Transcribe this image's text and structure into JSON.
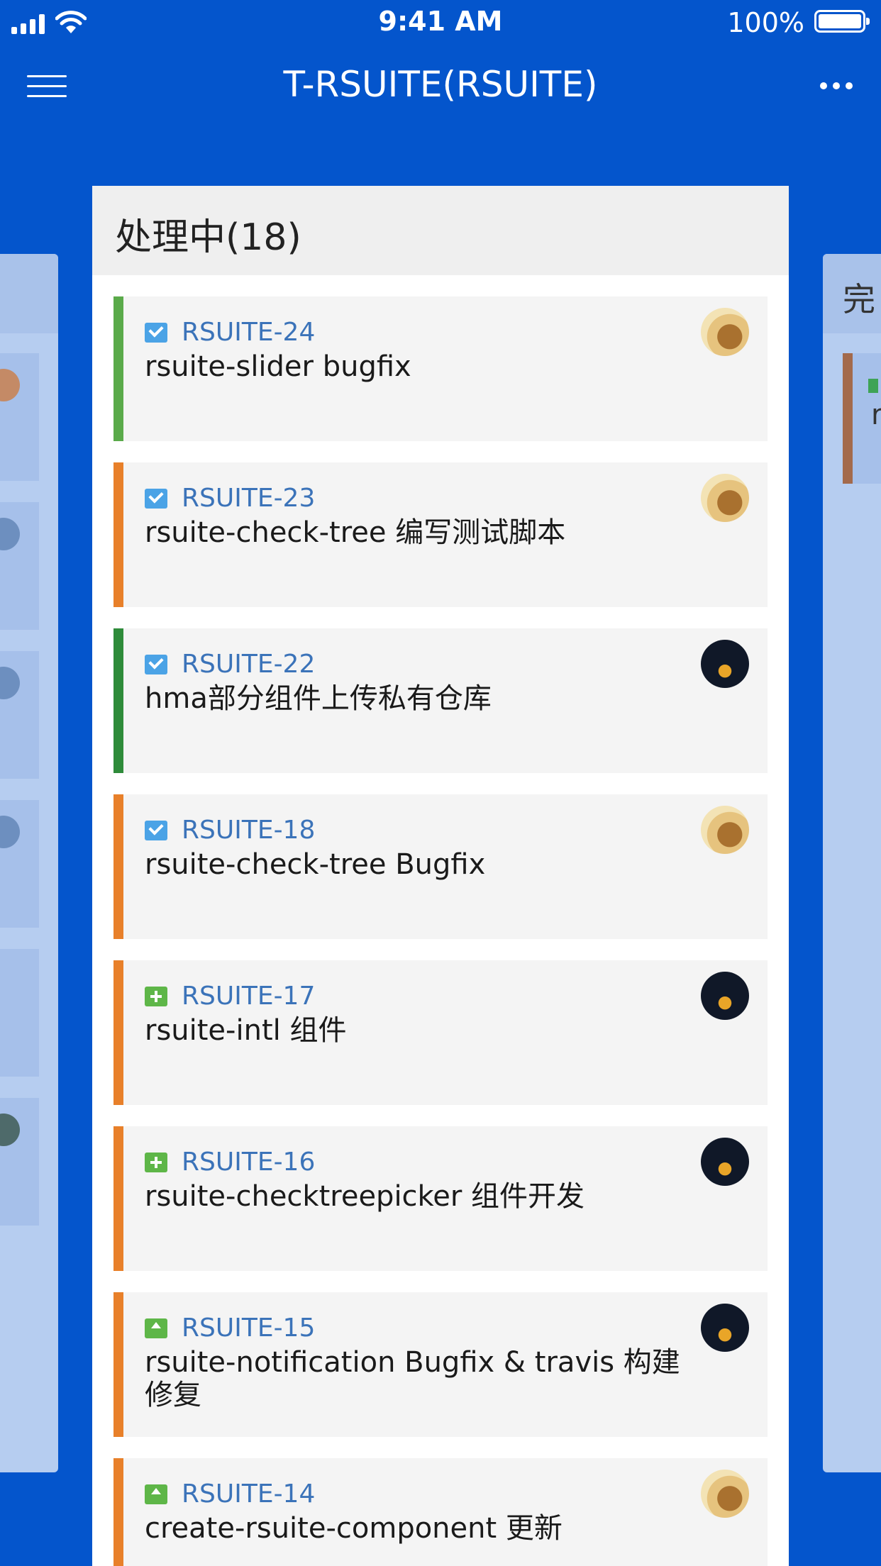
{
  "status_bar": {
    "time": "9:41 AM",
    "battery": "100%"
  },
  "nav": {
    "title": "T-RSUITE(RSUITE)"
  },
  "column": {
    "title": "处理中(18)",
    "cards": [
      {
        "key": "RSUITE-24",
        "title": "rsuite-slider bugfix",
        "type_icon": "task-icon",
        "avatar": "cat-avatar",
        "accent_color": "#5aaa4a"
      },
      {
        "key": "RSUITE-23",
        "title": "rsuite-check-tree 编写测试脚本",
        "type_icon": "task-icon",
        "avatar": "cat-avatar",
        "accent_color": "#e8802a"
      },
      {
        "key": "RSUITE-22",
        "title": "hma部分组件上传私有仓库",
        "type_icon": "task-icon",
        "avatar": "dark-avatar",
        "accent_color": "#2e8b3a"
      },
      {
        "key": "RSUITE-18",
        "title": "rsuite-check-tree Bugfix",
        "type_icon": "task-icon",
        "avatar": "cat-avatar",
        "accent_color": "#e8802a"
      },
      {
        "key": "RSUITE-17",
        "title": "rsuite-intl 组件",
        "type_icon": "new-feature-icon",
        "avatar": "dark-avatar",
        "accent_color": "#e8802a"
      },
      {
        "key": "RSUITE-16",
        "title": "rsuite-checktreepicker 组件开发",
        "type_icon": "new-feature-icon",
        "avatar": "dark-avatar",
        "accent_color": "#e8802a"
      },
      {
        "key": "RSUITE-15",
        "title": "rsuite-notification Bugfix & travis 构建修复",
        "type_icon": "improvement-icon",
        "avatar": "dark-avatar",
        "accent_color": "#e8802a"
      },
      {
        "key": "RSUITE-14",
        "title": "create-rsuite-component 更新",
        "type_icon": "improvement-icon",
        "avatar": "cat-avatar",
        "accent_color": "#e8802a"
      }
    ]
  },
  "side_right": {
    "title": "完",
    "card_text": "r"
  },
  "colors": {
    "nav_background": "#0455cc",
    "card_background": "#f4f4f4",
    "key_text": "#3b73b9"
  }
}
